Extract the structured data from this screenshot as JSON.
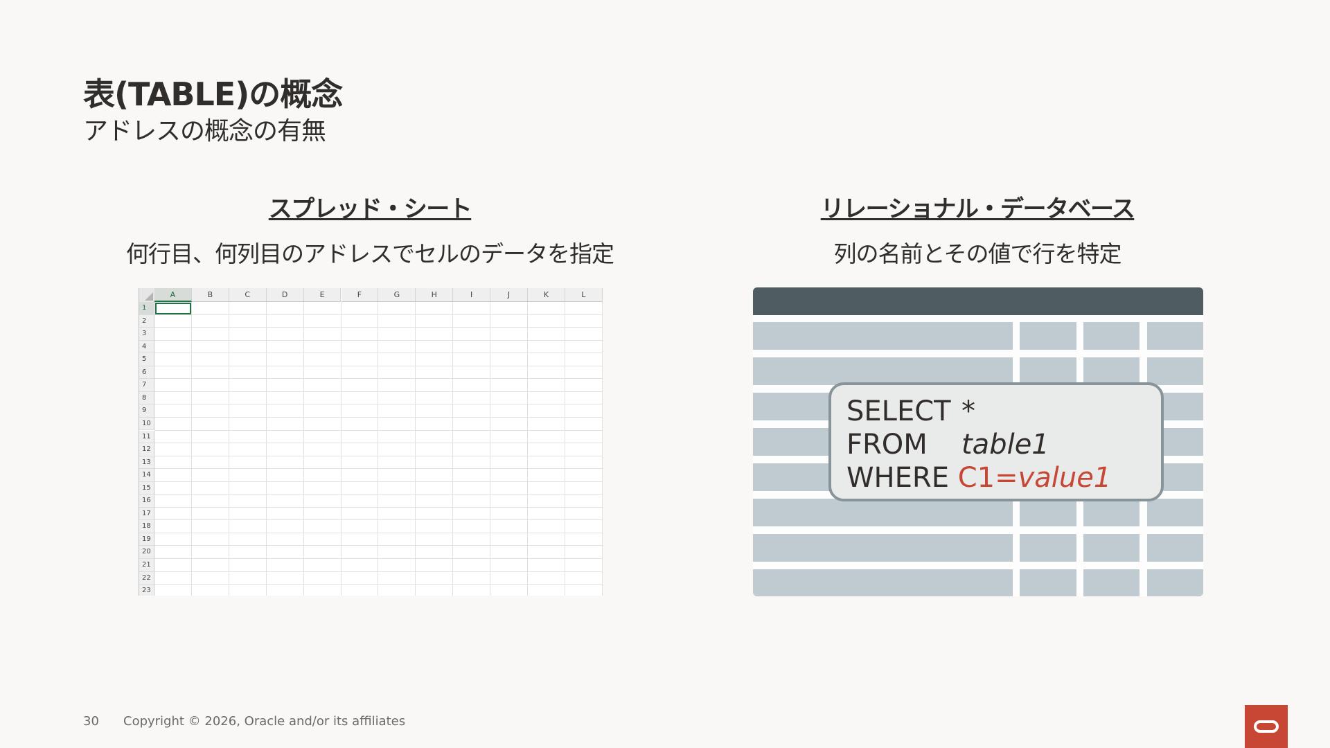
{
  "slide": {
    "title": "表(TABLE)の概念",
    "subtitle": "アドレスの概念の有無"
  },
  "left": {
    "heading": "スプレッド・シート",
    "description": "何行目、何列目のアドレスでセルのデータを指定",
    "columns": [
      "A",
      "B",
      "C",
      "D",
      "E",
      "F",
      "G",
      "H",
      "I",
      "J",
      "K",
      "L"
    ],
    "rows": [
      "1",
      "2",
      "3",
      "4",
      "5",
      "6",
      "7",
      "8",
      "9",
      "10",
      "11",
      "12",
      "13",
      "14",
      "15",
      "16",
      "17",
      "18",
      "19",
      "20",
      "21",
      "22",
      "23"
    ],
    "active_cell": "A1"
  },
  "right": {
    "heading": "リレーショナル・データベース",
    "description": "列の名前とその値で行を特定",
    "sql": {
      "select_kw": "SELECT",
      "select_val": "*",
      "from_kw": "FROM",
      "from_val": "table1",
      "where_kw": "WHERE",
      "where_col": "C1=",
      "where_val": "value1"
    }
  },
  "footer": {
    "page_number": "30",
    "copyright": "Copyright © 2026, Oracle and/or its affiliates"
  },
  "colors": {
    "accent_red": "#c74634",
    "db_header": "#4f5d63",
    "db_cell": "#bfcbd0",
    "excel_green": "#217346"
  }
}
